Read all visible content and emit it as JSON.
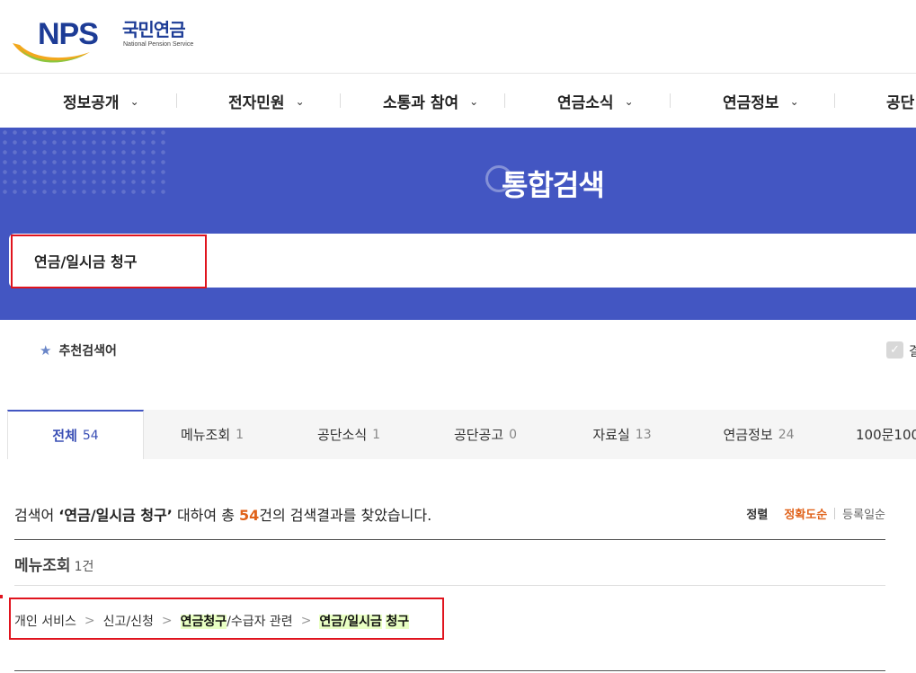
{
  "logo": {
    "mark": "NPS",
    "name_ko": "국민연금",
    "name_en": "National Pension Service"
  },
  "gnb": {
    "items": [
      {
        "label": "정보공개",
        "icon": "chevron-down-icon"
      },
      {
        "label": "전자민원",
        "icon": "chevron-down-icon"
      },
      {
        "label": "소통과 참여",
        "icon": "chevron-down-icon"
      },
      {
        "label": "연금소식",
        "icon": "chevron-down-icon"
      },
      {
        "label": "연금정보",
        "icon": "chevron-down-icon"
      },
      {
        "label": "공단"
      }
    ],
    "chevron": "⌄"
  },
  "banner": {
    "title": "통합검색"
  },
  "search": {
    "value": "연금/일시금 청구"
  },
  "recommend": {
    "label": "추천검색어",
    "icon": "star-icon"
  },
  "result_option": {
    "label": "결",
    "checked": true
  },
  "tabs": [
    {
      "label": "전체",
      "count": "54",
      "active": true
    },
    {
      "label": "메뉴조회",
      "count": "1"
    },
    {
      "label": "공단소식",
      "count": "1"
    },
    {
      "label": "공단공고",
      "count": "0"
    },
    {
      "label": "자료실",
      "count": "13"
    },
    {
      "label": "연금정보",
      "count": "24"
    },
    {
      "label": "100문100"
    }
  ],
  "summary": {
    "prefix": "검색어 ",
    "keyword": "‘연금/일시금 청구’",
    "mid": " 대하여 총 ",
    "count": "54",
    "suffix": "건의 검색결과를 찾았습니다."
  },
  "sort": {
    "label": "정렬",
    "accuracy": "정확도순",
    "date": "등록일순"
  },
  "section": {
    "title": "메뉴조회",
    "count": "1건"
  },
  "breadcrumb": {
    "items": [
      "개인 서비스",
      "신고/신청",
      "연금청구/수급자 관련",
      "연금/일시금 청구"
    ],
    "separator": ">",
    "marks": {
      "item3_mark": "연금청구",
      "item3_rest": "/수급자 관련",
      "item4_mark1": "연금/일시금",
      "item4_mark2": "청구"
    }
  },
  "colors": {
    "brand_blue": "#4356c2",
    "accent_orange": "#e0621a",
    "highlight_red": "#e0141e",
    "mark_green": "#e9ffc4"
  }
}
